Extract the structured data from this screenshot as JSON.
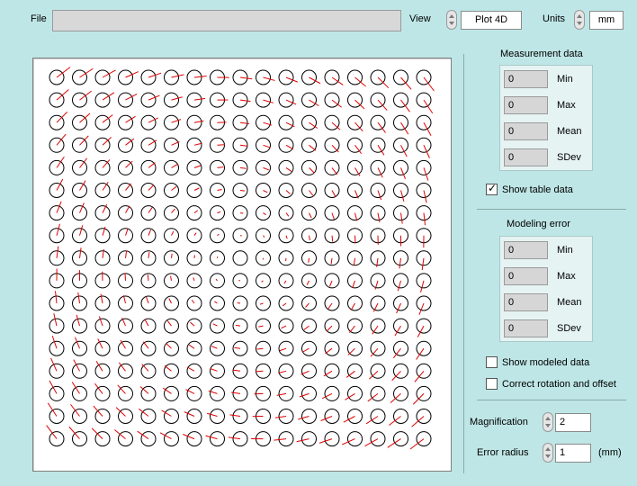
{
  "header": {
    "file_label": "File",
    "file_value": "",
    "view_label": "View",
    "view_value": "Plot 4D",
    "units_label": "Units",
    "units_value": "mm"
  },
  "measurement": {
    "title": "Measurement data",
    "stats": [
      {
        "value": "0",
        "label": "Min"
      },
      {
        "value": "0",
        "label": "Max"
      },
      {
        "value": "0",
        "label": "Mean"
      },
      {
        "value": "0",
        "label": "SDev"
      }
    ],
    "show_table_label": "Show table data",
    "show_table_checked": true
  },
  "modeling": {
    "title": "Modeling error",
    "stats": [
      {
        "value": "0",
        "label": "Min"
      },
      {
        "value": "0",
        "label": "Max"
      },
      {
        "value": "0",
        "label": "Mean"
      },
      {
        "value": "0",
        "label": "SDev"
      }
    ],
    "show_modeled_label": "Show modeled data",
    "show_modeled_checked": false,
    "correct_rotation_label": "Correct rotation and offset",
    "correct_rotation_checked": false
  },
  "controls": {
    "magnification_label": "Magnification",
    "magnification_value": "2",
    "error_radius_label": "Error radius",
    "error_radius_value": "1",
    "error_radius_unit": "(mm)"
  },
  "plot": {
    "grid_rows": 17,
    "grid_cols": 17,
    "circle_color": "#000000",
    "vector_color": "#e00000"
  }
}
